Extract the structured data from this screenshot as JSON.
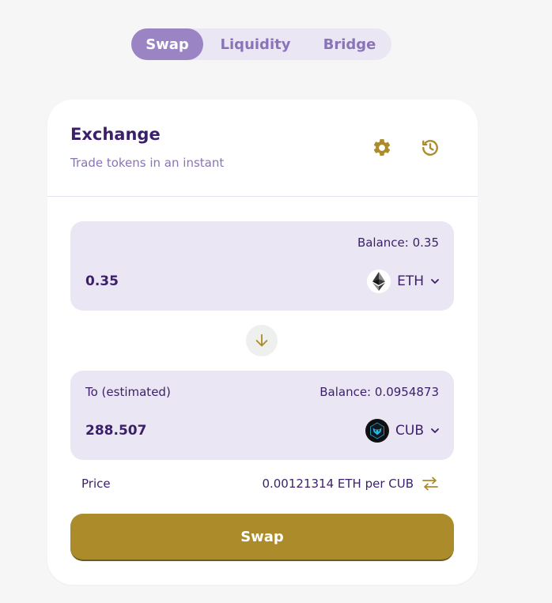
{
  "tabs": [
    {
      "label": "Swap",
      "active": true
    },
    {
      "label": "Liquidity",
      "active": false
    },
    {
      "label": "Bridge",
      "active": false
    }
  ],
  "card": {
    "title": "Exchange",
    "subtitle": "Trade tokens in an instant",
    "settings_icon": "gear-icon",
    "history_icon": "history-icon"
  },
  "from": {
    "balance": "Balance: 0.35",
    "amount": "0.35",
    "token": "ETH"
  },
  "to": {
    "label": "To (estimated)",
    "balance": "Balance: 0.0954873",
    "amount": "288.507",
    "token": "CUB"
  },
  "price": {
    "label": "Price",
    "value": "0.00121314 ETH per CUB"
  },
  "swap_button": "Swap",
  "colors": {
    "accent_gold": "#ac8b2a",
    "tab_active": "#9a84c3",
    "text_primary": "#3b1f6b",
    "text_secondary": "#8a73b8",
    "panel_bg": "#ebe6f3"
  }
}
